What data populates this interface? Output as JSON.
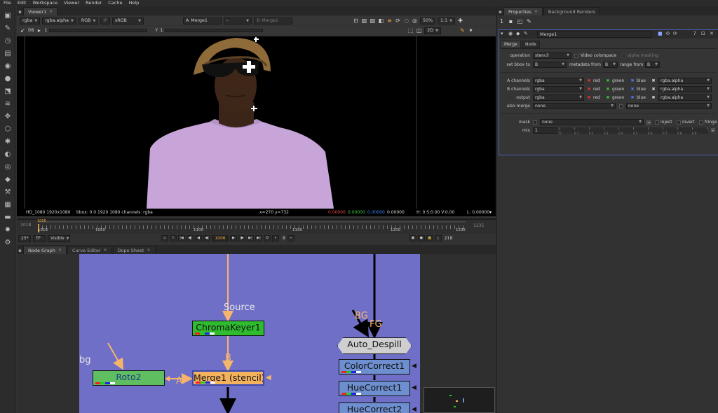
{
  "menubar": [
    "File",
    "Edit",
    "Workspace",
    "Viewer",
    "Render",
    "Cache",
    "Help"
  ],
  "viewer_tab": {
    "label": "Viewer1"
  },
  "viewer_controls": {
    "channels": "rgba",
    "channel_alpha": "rgba.alpha",
    "colorspace_mode": "RGB",
    "ip": "IP",
    "lut": "sRGB",
    "input_a_prefix": "A",
    "input_a": "Merge1",
    "input_b_prefix": "B",
    "input_b": "Merge1",
    "wipe": "-",
    "zoom": "50%",
    "proxy": "1:1",
    "gain_label": "f/8",
    "gain_value": "1",
    "gamma_label": "Y",
    "gamma_value": "1",
    "view_mode": "2D"
  },
  "viewer_info": {
    "format": "HD_1080 1920x1080",
    "bbox": "bbox: 0 0 1920 1080 channels: rgba",
    "coords": "x=270 y=732",
    "r": "0.00000",
    "g": "0.00000",
    "b": "0.00000",
    "a": "0.00000",
    "hsv": "H:  0 S:0.00 V:0.00",
    "lum": "L: 0.00000"
  },
  "timeline": {
    "start": "1018",
    "end": "1235",
    "current_marker": "1006",
    "ticks": [
      "1018",
      "1050",
      "1100",
      "1150",
      "1200",
      "1235"
    ],
    "fps": "25*",
    "tf": "TF",
    "visible": "Visible",
    "current_frame": "1006",
    "step": "8",
    "frame_range_end": "218"
  },
  "node_graph_tabs": [
    "Node Graph",
    "Curve Editor",
    "Dope Sheet"
  ],
  "node_graph": {
    "labels": {
      "source": "Source",
      "bg_label": "bg",
      "b_input": "B",
      "a_input": "A",
      "bg_input": "BG",
      "fg_input": "FG"
    },
    "nodes": {
      "chromakeyer": "ChromaKeyer1",
      "roto": "Roto2",
      "merge": "Merge1 (stencil)",
      "despill": "Auto_Despill",
      "cc": "ColorCorrect1",
      "hue1": "HueCorrect1",
      "hue2": "HueCorrect2"
    }
  },
  "properties": {
    "tabs": [
      "Properties",
      "Background Renders"
    ],
    "node_name": "Merge1",
    "subtabs": [
      "Merge",
      "Node"
    ],
    "operation_label": "operation",
    "operation_value": "stencil",
    "video_colorspace": "Video colorspace",
    "alpha_masking": "alpha masking",
    "set_bbox_label": "set bbox to",
    "set_bbox_value": "B",
    "metadata_label": "metadata from",
    "metadata_value": "B",
    "range_label": "range from",
    "range_value": "B",
    "a_channels_label": "A channels",
    "b_channels_label": "B channels",
    "output_label": "output",
    "channel_value": "rgba",
    "alpha_value": "rgba.alpha",
    "red": "red",
    "green": "green",
    "blue": "blue",
    "also_merge_label": "also merge",
    "also_merge_value": "none",
    "also_merge_value2": "none",
    "mask_label": "mask",
    "mask_value": "none",
    "inject": "inject",
    "invert": "invert",
    "fringe": "fringe",
    "mix_label": "mix",
    "mix_value": "1",
    "mix_ticks": [
      "0",
      "0.1",
      "0.2",
      "0.3",
      "0.4",
      "0.5",
      "0.6",
      "0.7",
      "0.8",
      "0.9"
    ]
  },
  "colors": {
    "node_graph_bg": "#6f6fc7",
    "chromakeyer_node": "#2fbd2f",
    "roto_node": "#5fbe5f",
    "merge_node": "#f5b25c",
    "despill_node": "#cfcfcf",
    "cc_node": "#6e8fcf",
    "pipe_orange": "#f7b56b",
    "prop_border": "#4b5fb1"
  }
}
